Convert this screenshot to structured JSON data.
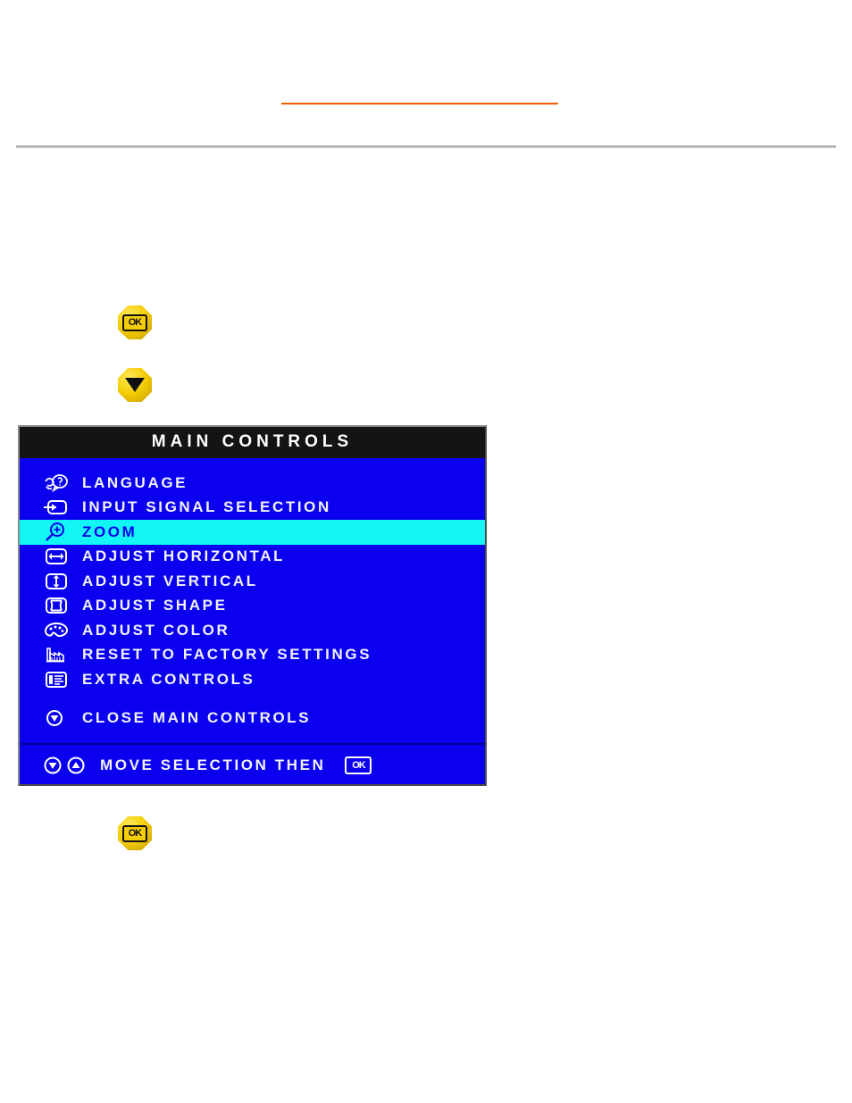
{
  "page": {
    "background_color": "#ffffff",
    "accent_orange": "#f15a00",
    "rule_gray": "#9e9e9e"
  },
  "buttons": {
    "ok_top": {
      "glyph_label": "OK",
      "icon": "ok-octagon-button",
      "color": "#f2c500"
    },
    "down_arrow": {
      "glyph_label": "",
      "icon": "down-arrow-octagon-button",
      "color": "#f2c500"
    },
    "ok_bottom": {
      "glyph_label": "OK",
      "icon": "ok-octagon-button",
      "color": "#f2c500"
    }
  },
  "osd": {
    "title": "MAIN CONTROLS",
    "title_bg": "#141414",
    "body_bg": "#0a00ef",
    "highlight_bg": "#13f6f6",
    "text_color": "#f2f2ff",
    "highlight_text_color": "#0a00ef",
    "items": [
      {
        "label": "LANGUAGE",
        "icon": "language-speech-icon",
        "selected": false
      },
      {
        "label": "INPUT SIGNAL SELECTION",
        "icon": "input-signal-icon",
        "selected": false
      },
      {
        "label": "ZOOM",
        "icon": "zoom-magnifier-icon",
        "selected": true
      },
      {
        "label": "ADJUST HORIZONTAL",
        "icon": "adjust-horizontal-icon",
        "selected": false
      },
      {
        "label": "ADJUST VERTICAL",
        "icon": "adjust-vertical-icon",
        "selected": false
      },
      {
        "label": "ADJUST SHAPE",
        "icon": "adjust-shape-icon",
        "selected": false
      },
      {
        "label": "ADJUST COLOR",
        "icon": "adjust-color-palette-icon",
        "selected": false
      },
      {
        "label": "RESET TO FACTORY SETTINGS",
        "icon": "factory-reset-icon",
        "selected": false
      },
      {
        "label": "EXTRA CONTROLS",
        "icon": "extra-controls-list-icon",
        "selected": false
      }
    ],
    "close_item": {
      "label": "CLOSE MAIN CONTROLS",
      "icon": "close-down-circle-icon"
    },
    "footer": {
      "hint": "MOVE SELECTION THEN",
      "ok_label": "OK",
      "icon_down": "move-down-circle-icon",
      "icon_up": "move-up-circle-icon"
    }
  }
}
